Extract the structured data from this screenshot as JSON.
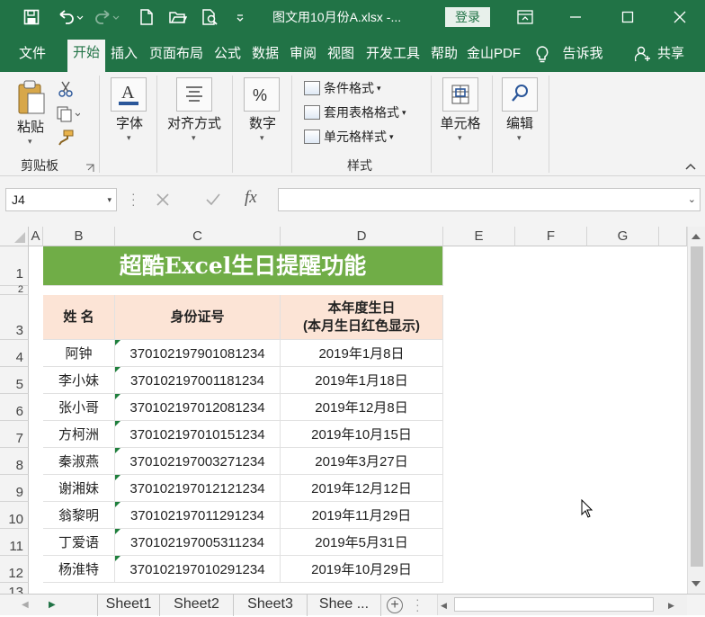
{
  "window": {
    "title": "图文用10月份A.xlsx  -...",
    "login_label": "登录"
  },
  "tabs": [
    "文件",
    "开始",
    "插入",
    "页面布局",
    "公式",
    "数据",
    "审阅",
    "视图",
    "开发工具",
    "帮助",
    "金山PDF"
  ],
  "active_tab": "开始",
  "tell_me": "告诉我",
  "share": "共享",
  "ribbon": {
    "paste": "粘贴",
    "clipboard_group": "剪贴板",
    "font": "字体",
    "alignment": "对齐方式",
    "number": "数字",
    "conditional_format": "条件格式",
    "table_format": "套用表格格式",
    "cell_styles": "单元格样式",
    "styles_group": "样式",
    "cells": "单元格",
    "editing": "编辑"
  },
  "formula_bar": {
    "name_box": "J4",
    "fx": "fx",
    "formula": ""
  },
  "columns": [
    "A",
    "B",
    "C",
    "D",
    "E",
    "F",
    "G"
  ],
  "rows": [
    "1",
    "2",
    "3",
    "4",
    "5",
    "6",
    "7",
    "8",
    "9",
    "10",
    "11",
    "12",
    "13"
  ],
  "sheet": {
    "title": "超酷Excel生日提醒功能",
    "headers": {
      "name": "姓  名",
      "id": "身份证号",
      "birthday_line1": "本年度生日",
      "birthday_line2": "(本月生日红色显示)"
    },
    "records": [
      {
        "name": "阿钟",
        "id": "370102197901081234",
        "birthday": "2019年1月8日"
      },
      {
        "name": "李小妹",
        "id": "370102197001181234",
        "birthday": "2019年1月18日"
      },
      {
        "name": "张小哥",
        "id": "370102197012081234",
        "birthday": "2019年12月8日"
      },
      {
        "name": "方柯洲",
        "id": "370102197010151234",
        "birthday": "2019年10月15日"
      },
      {
        "name": "秦淑燕",
        "id": "370102197003271234",
        "birthday": "2019年3月27日"
      },
      {
        "name": "谢湘妹",
        "id": "370102197012121234",
        "birthday": "2019年12月12日"
      },
      {
        "name": "翁黎明",
        "id": "370102197011291234",
        "birthday": "2019年11月29日"
      },
      {
        "name": "丁爱语",
        "id": "370102197005311234",
        "birthday": "2019年5月31日"
      },
      {
        "name": "杨淮特",
        "id": "370102197010291234",
        "birthday": "2019年10月29日"
      }
    ]
  },
  "sheet_tabs": [
    "Sheet1",
    "Sheet2",
    "Sheet3",
    "Shee ..."
  ],
  "colors": {
    "brand": "#217346",
    "title_fill": "#70ad47",
    "header_fill": "#fce4d6"
  }
}
